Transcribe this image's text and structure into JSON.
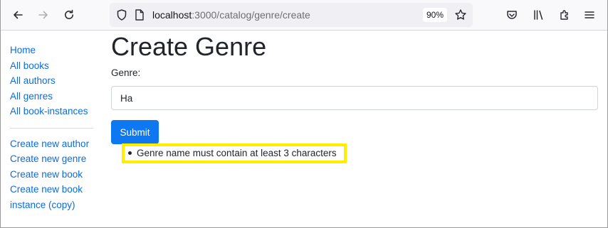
{
  "browser": {
    "url_host": "localhost",
    "url_rest": ":3000/catalog/genre/create",
    "zoom": "90%",
    "icons": {
      "back": "back-arrow-icon",
      "forward": "forward-arrow-icon",
      "reload": "reload-icon",
      "shield": "shield-icon",
      "page": "page-icon",
      "bookmark": "bookmark-star-icon",
      "pocket": "pocket-icon",
      "library": "library-icon",
      "extensions": "extensions-icon",
      "menu": "hamburger-menu-icon"
    }
  },
  "sidebar": {
    "primary": [
      {
        "label": "Home"
      },
      {
        "label": "All books"
      },
      {
        "label": "All authors"
      },
      {
        "label": "All genres"
      },
      {
        "label": "All book-instances"
      }
    ],
    "secondary": [
      {
        "label": "Create new author"
      },
      {
        "label": "Create new genre"
      },
      {
        "label": "Create new book"
      },
      {
        "label": "Create new book instance (copy)"
      }
    ]
  },
  "main": {
    "title": "Create Genre",
    "genre_label": "Genre:",
    "genre_value": "Ha",
    "submit_label": "Submit",
    "errors": [
      "Genre name must contain at least 3 characters"
    ]
  },
  "colors": {
    "link": "#0b6ce0",
    "primary_button": "#0d78f2",
    "highlight": "#ffee00"
  }
}
